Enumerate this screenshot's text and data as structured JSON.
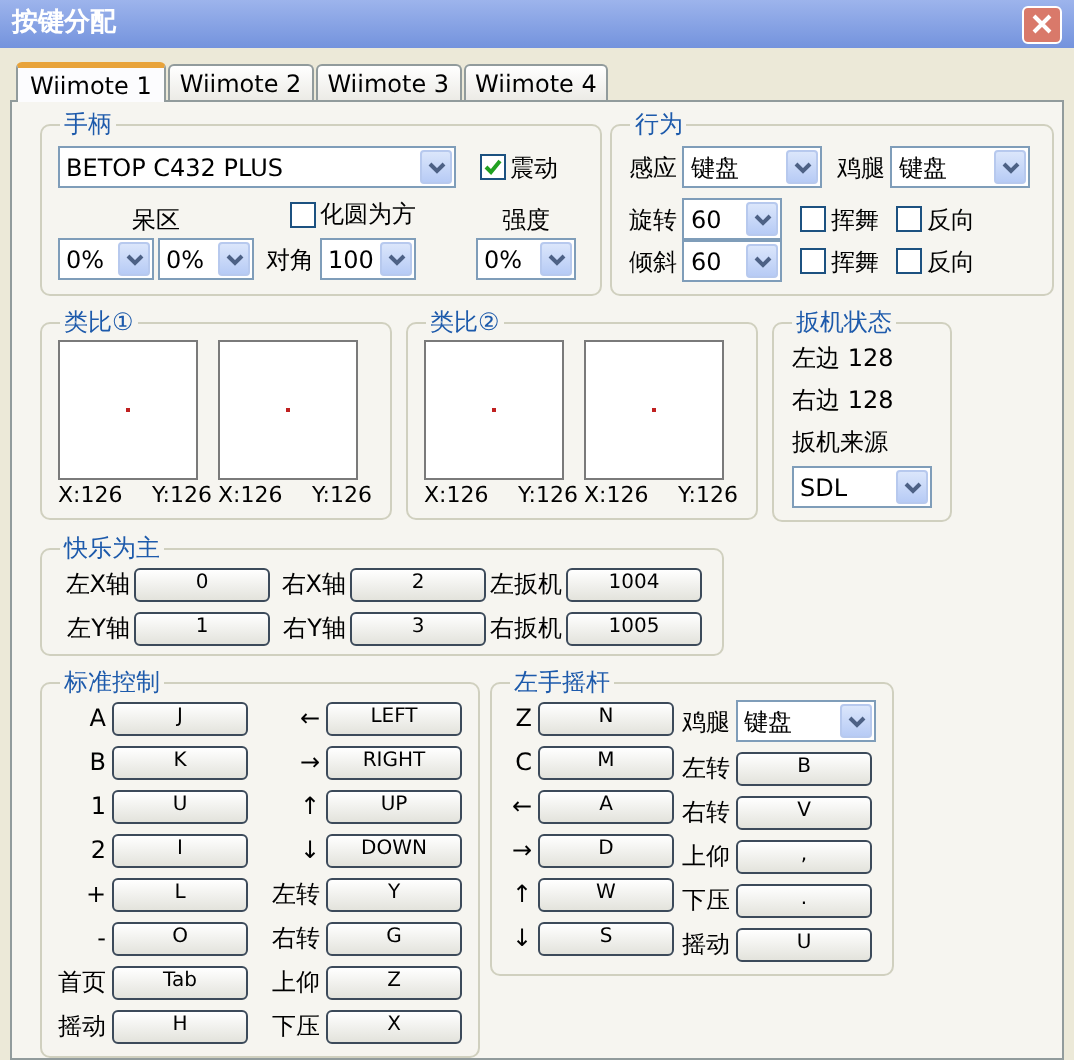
{
  "window": {
    "title": "按键分配"
  },
  "tabs": [
    {
      "label": "Wiimote 1",
      "selected": true
    },
    {
      "label": "Wiimote 2",
      "selected": false
    },
    {
      "label": "Wiimote 3",
      "selected": false
    },
    {
      "label": "Wiimote 4",
      "selected": false
    }
  ],
  "controller": {
    "title": "手柄",
    "device": "BETOP C432 PLUS",
    "rumble": {
      "label": "震动",
      "checked": true
    },
    "deadzone": {
      "label": "呆区",
      "values": [
        "0%",
        "0%"
      ]
    },
    "square": {
      "label": "化圆为方",
      "checked": false
    },
    "diagonal": {
      "label": "对角",
      "value": "100"
    },
    "strength": {
      "label": "强度",
      "value": "0%"
    }
  },
  "behavior": {
    "title": "行为",
    "selects": [
      {
        "label": "感应",
        "value": "键盘"
      },
      {
        "label": "鸡腿",
        "value": "键盘"
      }
    ],
    "rows": [
      {
        "label": "旋转",
        "value": "60",
        "options": [
          {
            "label": "挥舞",
            "checked": false
          },
          {
            "label": "反向",
            "checked": false
          }
        ]
      },
      {
        "label": "倾斜",
        "value": "60",
        "options": [
          {
            "label": "挥舞",
            "checked": false
          },
          {
            "label": "反向",
            "checked": false
          }
        ]
      }
    ]
  },
  "analogs": [
    {
      "title": "类比①",
      "sticks": [
        {
          "x": "X:126",
          "y": "Y:126"
        },
        {
          "x": "X:126",
          "y": "Y:126"
        }
      ]
    },
    {
      "title": "类比②",
      "sticks": [
        {
          "x": "X:126",
          "y": "Y:126"
        },
        {
          "x": "X:126",
          "y": "Y:126"
        }
      ]
    }
  ],
  "trigger_status": {
    "title": "扳机状态",
    "lines": [
      "左边 128",
      "右边 128"
    ],
    "source_label": "扳机来源",
    "source": "SDL"
  },
  "axes": {
    "title": "快乐为主",
    "items": [
      {
        "label": "左X轴",
        "value": "0"
      },
      {
        "label": "右X轴",
        "value": "2"
      },
      {
        "label": "左扳机",
        "value": "1004"
      },
      {
        "label": "左Y轴",
        "value": "1"
      },
      {
        "label": "右Y轴",
        "value": "3"
      },
      {
        "label": "右扳机",
        "value": "1005"
      }
    ]
  },
  "standard": {
    "title": "标准控制",
    "columns": [
      [
        {
          "label": "A",
          "key": "J"
        },
        {
          "label": "B",
          "key": "K"
        },
        {
          "label": "1",
          "key": "U"
        },
        {
          "label": "2",
          "key": "I"
        },
        {
          "label": "+",
          "key": "L"
        },
        {
          "label": "-",
          "key": "O"
        },
        {
          "label": "首页",
          "key": "Tab"
        },
        {
          "label": "摇动",
          "key": "H"
        }
      ],
      [
        {
          "label": "←",
          "key": "LEFT"
        },
        {
          "label": "→",
          "key": "RIGHT"
        },
        {
          "label": "↑",
          "key": "UP"
        },
        {
          "label": "↓",
          "key": "DOWN"
        },
        {
          "label": "左转",
          "key": "Y"
        },
        {
          "label": "右转",
          "key": "G"
        },
        {
          "label": "上仰",
          "key": "Z"
        },
        {
          "label": "下压",
          "key": "X"
        }
      ]
    ]
  },
  "left_stick": {
    "title": "左手摇杆",
    "keys": [
      {
        "label": "Z",
        "key": "N"
      },
      {
        "label": "C",
        "key": "M"
      },
      {
        "label": "←",
        "key": "A"
      },
      {
        "label": "→",
        "key": "D"
      },
      {
        "label": "↑",
        "key": "W"
      },
      {
        "label": "↓",
        "key": "S"
      }
    ],
    "nunchuk": {
      "label": "鸡腿",
      "value": "键盘"
    },
    "motions": [
      {
        "label": "左转",
        "key": "B"
      },
      {
        "label": "右转",
        "key": "V"
      },
      {
        "label": "上仰",
        "key": ","
      },
      {
        "label": "下压",
        "key": "."
      },
      {
        "label": "摇动",
        "key": "U"
      }
    ]
  }
}
